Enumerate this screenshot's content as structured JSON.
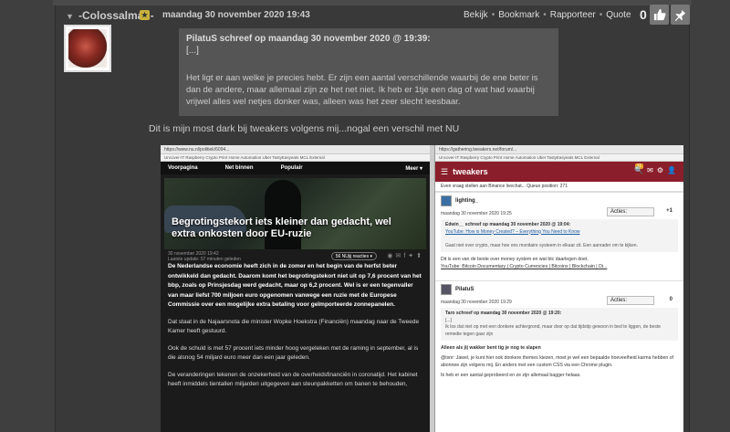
{
  "post": {
    "username": "-Colossalman-",
    "date": "maandag 30 november 2020 19:43",
    "actions": [
      "Bekijk",
      "Bookmark",
      "Rapporteer",
      "Quote"
    ],
    "score": "0",
    "quote": {
      "header": "PilatuS schreef op maandag 30 november 2020 @ 19:39:",
      "ellipsis": "[...]",
      "body": "Het ligt er aan welke je precies hebt. Er zijn een aantal verschillende waarbij de ene beter is dan de andere, maar allemaal zijn ze het net niet. Ik heb er 1tje een dag of wat had waarbij vrijwel alles wel netjes donker was, alleen was het zeer slecht leesbaar."
    },
    "text": "Dit is mijn most dark bij tweakers volgens mij...nogal een verschil met NU"
  },
  "nu": {
    "url": "https://www.nu.nl/politiek/6094...",
    "bookmarks": "Uncover-IT  Raspberry  Crypto  Print  Home Automation  Uber  TastyEasyeats  MCL External",
    "nav": [
      "Voorpagina",
      "Net binnen",
      "Populair",
      "Meer ▾"
    ],
    "title": "Begrotingstekort iets kleiner dan gedacht, wel extra onkosten door EU-ruzie",
    "meta_date": "30 november 2020 19:42",
    "meta_update": "Laatste update: 57 minuten geleden",
    "reactions": "56 NUjij reacties ▾",
    "paragraphs": [
      "De Nederlandse economie heeft zich in de zomer en het begin van de herfst beter ontwikkeld dan gedacht. Daarom komt het begrotingstekort niet uit op 7,6 procent van het bbp, zoals op Prinsjesdag werd gedacht, maar op 6,2 procent. Wel is er een tegenvaller van maar liefst 700 miljoen euro opgenomen vanwege een ruzie met de Europese Commissie over een mogelijke extra betaling voor geïmporteerde zonnepanelen.",
      "Dat staat in de Najaarsnota die minister Wopke Hoekstra (Financiën) maandag naar de Tweede Kamer heeft gestuurd.",
      "Ook de schuld is met 57 procent iets minder hoog vergeleken met de raming in september, al is die alsnog 54 miljard euro meer dan een jaar geleden.",
      "De veranderingen tekenen de onzekerheid van de overheidsfinanciën in coronatijd. Het kabinet heeft inmiddels tientallen miljarden uitgegeven aan steunpakketten om banen te behouden,"
    ]
  },
  "tw": {
    "url": "https://gathering.tweakers.net/forum/...",
    "logo": "tweakers",
    "notif": "11",
    "sub": "Even vraag stellen aan Binance livechat... Queue position: 271",
    "post1": {
      "user": "lighting_",
      "date": "maandag 30 november 2020 19:25",
      "acties": "Acties:",
      "score": "+1",
      "quote_head": "Edwin__ schreef op maandag 30 november 2020 @ 19:04:",
      "quote_link": "YouTube: How is Money Created? – Everything You Need to Know",
      "quote_text": "Gaat niet over crypto, maar hoe ons monitaire systeem in elkaar zit. Een aanrader om te kijken.",
      "text": "Dit is een van de beste over money system en wat btc daarlegen doet.",
      "link": "YouTube: Bitcoin Documentary | Crypto Currencies | Bitcoins | Blockchain | Di..."
    },
    "post2": {
      "user": "PilatuS",
      "date": "maandag 30 november 2020 19:29",
      "acties": "Acties:",
      "score": "0",
      "quote_head": "Taro schreef op maandag 30 november 2020 @ 19:20:",
      "quote_ellipsis": "[...]",
      "quote_text": "Ik los dat niet op met een donkere achtergrond, maar door op dat tijdstip gewoon in bed te liggen, de beste remedie tegen gaar zijn",
      "heading": "Alleen als jij wakker bent tig je nog te slapen",
      "text": "@txnr: Jawel, je kunt hier ook donkere themes kiezen, moet je wel een bepaalde hoeveelheid karma hebben of abonnee zijn volgens mij. En anders met een custom CSS via een Chrome plugin.",
      "text2": "Ik heb er een aantal geprobeerd en ze zijn allemaal bagger helaas."
    }
  }
}
